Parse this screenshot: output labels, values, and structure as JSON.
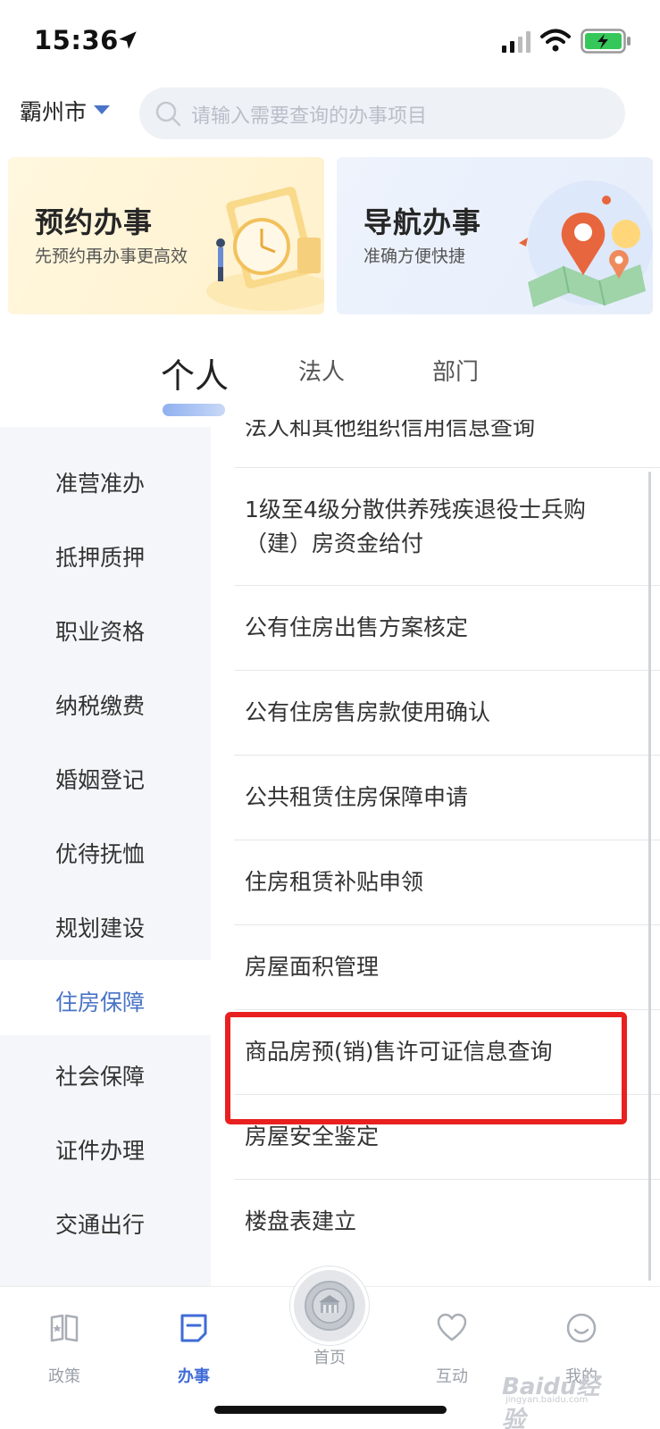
{
  "status_bar": {
    "time": "15:36"
  },
  "header": {
    "city": "霸州市",
    "search_placeholder": "请输入需要查询的办事项目"
  },
  "banners": [
    {
      "title": "预约办事",
      "subtitle": "先预约再办事更高效"
    },
    {
      "title": "导航办事",
      "subtitle": "准确方便快捷"
    }
  ],
  "tabs": [
    {
      "label": "个人",
      "active": true
    },
    {
      "label": "法人",
      "active": false
    },
    {
      "label": "部门",
      "active": false
    }
  ],
  "categories": [
    {
      "label": "准营准办"
    },
    {
      "label": "抵押质押"
    },
    {
      "label": "职业资格"
    },
    {
      "label": "纳税缴费"
    },
    {
      "label": "婚姻登记"
    },
    {
      "label": "优待抚恤"
    },
    {
      "label": "规划建设"
    },
    {
      "label": "住房保障",
      "active": true
    },
    {
      "label": "社会保障"
    },
    {
      "label": "证件办理"
    },
    {
      "label": "交通出行"
    }
  ],
  "items": [
    {
      "label": "法人和其他组织信用信息查询"
    },
    {
      "label": "1级至4级分散供养残疾退役士兵购",
      "label_line2": "（建）房资金给付"
    },
    {
      "label": "公有住房出售方案核定"
    },
    {
      "label": "公有住房售房款使用确认"
    },
    {
      "label": "公共租赁住房保障申请"
    },
    {
      "label": "住房租赁补贴申领"
    },
    {
      "label": "房屋面积管理"
    },
    {
      "label": "商品房预(销)售许可证信息查询",
      "highlighted": true
    },
    {
      "label": "房屋安全鉴定"
    },
    {
      "label": "楼盘表建立"
    }
  ],
  "bottom_nav": [
    {
      "label": "政策",
      "icon": "policy-icon"
    },
    {
      "label": "办事",
      "icon": "affairs-icon",
      "active": true
    },
    {
      "label": "首页",
      "icon": "home-emblem-icon"
    },
    {
      "label": "互动",
      "icon": "heart-icon"
    },
    {
      "label": "我的",
      "icon": "smile-icon"
    }
  ],
  "watermark": {
    "main": "Baidu经验",
    "sub": "jingyan.baidu.com"
  },
  "colors": {
    "accent": "#3e6bd6",
    "category_active": "#4a73c6",
    "highlight": "#e8201f"
  }
}
